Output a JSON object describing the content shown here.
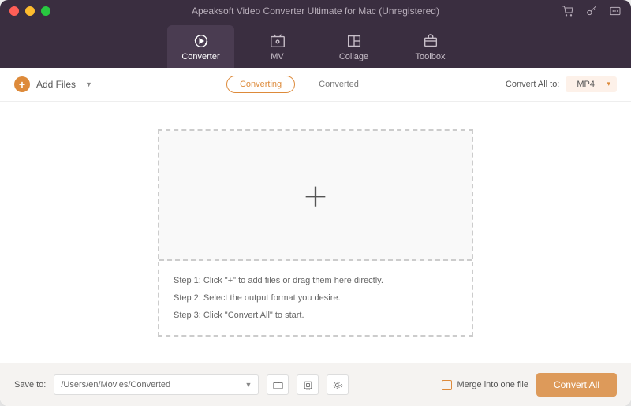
{
  "window": {
    "title": "Apeaksoft Video Converter Ultimate for Mac (Unregistered)"
  },
  "tabs": {
    "converter": "Converter",
    "mv": "MV",
    "collage": "Collage",
    "toolbox": "Toolbox"
  },
  "toolbar": {
    "add_files": "Add Files",
    "converting": "Converting",
    "converted": "Converted",
    "convert_all_to": "Convert All to:",
    "format": "MP4"
  },
  "steps": {
    "s1": "Step 1: Click \"+\" to add files or drag them here directly.",
    "s2": "Step 2: Select the output format you desire.",
    "s3": "Step 3: Click \"Convert All\" to start."
  },
  "footer": {
    "save_to_label": "Save to:",
    "save_to_path": "/Users/en/Movies/Converted",
    "merge_label": "Merge into one file",
    "convert_all": "Convert All"
  }
}
